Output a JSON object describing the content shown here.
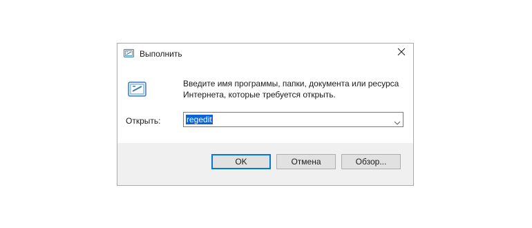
{
  "window": {
    "title": "Выполнить",
    "icon": "run-icon",
    "close_icon": "close-icon"
  },
  "content": {
    "icon": "run-icon",
    "description_line1": "Введите имя программы, папки, документа или ресурса",
    "description_line2": "Интернета, которые требуется открыть.",
    "open_label": "Открыть:",
    "open_value": "regedit",
    "dropdown_icon": "chevron-down-icon"
  },
  "buttons": {
    "ok": "OK",
    "cancel": "Отмена",
    "browse": "Обзор..."
  },
  "colors": {
    "selection": "#0a64d8",
    "footer_bg": "#f0f0f0",
    "default_button_border": "#0078d7"
  }
}
